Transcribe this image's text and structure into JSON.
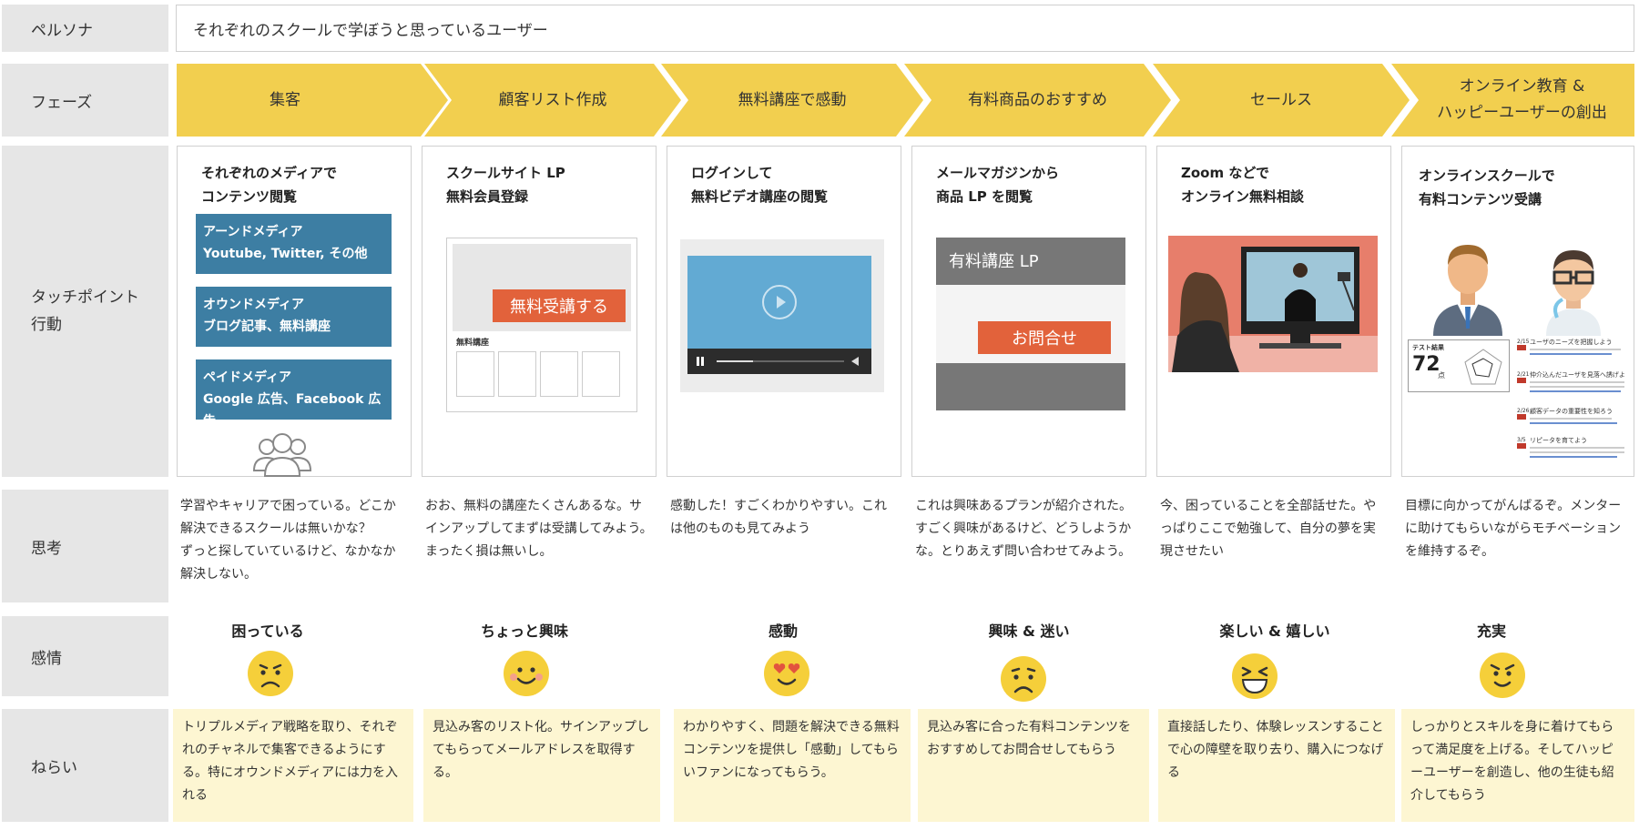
{
  "labels": {
    "persona": "ペルソナ",
    "phase": "フェーズ",
    "touchpoint": "タッチポイント\n行動",
    "thought": "思考",
    "emotion": "感情",
    "aim": "ねらい"
  },
  "persona": "それぞれのスクールで学ぼうと思っているユーザー",
  "phases": [
    "集客",
    "顧客リスト作成",
    "無料講座で感動",
    "有料商品のおすすめ",
    "セールス",
    "オンライン教育 &\nハッピーユーザーの創出"
  ],
  "touchpoints": [
    {
      "title": "それぞれのメディアで\nコンテンツ閲覧"
    },
    {
      "title": "スクールサイト LP\n無料会員登録"
    },
    {
      "title": "ログインして\n無料ビデオ講座の閲覧"
    },
    {
      "title": "メールマガジンから\n商品 LP を閲覧"
    },
    {
      "title": "Zoom などで\nオンライン無料相談"
    },
    {
      "title": "オンラインスクールで\n有料コンテンツ受講"
    }
  ],
  "media": [
    "アーンドメディア\nYoutube, Twitter, その他",
    "オウンドメディア\nブログ記事、無料講座",
    "ペイドメディア\nGoogle 広告、Facebook 広告"
  ],
  "lp": {
    "button": "無料受講する",
    "section": "無料講座"
  },
  "product_lp": {
    "header": "有料講座 LP",
    "button": "お問合せ"
  },
  "dashboard": {
    "score_label": "テスト結果",
    "score": "72",
    "score_unit": "点",
    "items": [
      {
        "date": "2/15",
        "title": "ユーザのニーズを把握しよう"
      },
      {
        "date": "2/21",
        "title": "仲介込んだユーザを見落へ誘げよ"
      },
      {
        "date": "2/26",
        "title": "顧客データの重要性を知ろう"
      },
      {
        "date": "3/5",
        "title": "リピータを育てよう"
      }
    ]
  },
  "thoughts": [
    "学習やキャリアで困っている。どこか解決できるスクールは無いかな？\nずっと探していているけど、なかなか解決しない。",
    "おお、無料の講座たくさんあるな。サインアップしてまずは受講してみよう。まったく損は無いし。",
    "感動した！すごくわかりやすい。これは他のものも見てみよう",
    "これは興味あるプランが紹介された。すごく興味があるけど、どうしようかな。とりあえず問い合わせてみよう。",
    "今、困っていることを全部話せた。やっぱりここで勉強して、自分の夢を実現させたい",
    "目標に向かってがんばるぞ。メンターに助けてもらいながらモチベーションを維持するぞ。"
  ],
  "emotions": [
    {
      "name": "困っている",
      "icon": "worried-face-icon"
    },
    {
      "name": "ちょっと興味",
      "icon": "smile-face-icon"
    },
    {
      "name": "感動",
      "icon": "heart-eyes-face-icon"
    },
    {
      "name": "興味 & 迷い",
      "icon": "frown-face-icon"
    },
    {
      "name": "楽しい & 嬉しい",
      "icon": "laughing-face-icon"
    },
    {
      "name": "充実",
      "icon": "confident-face-icon"
    }
  ],
  "aims": [
    "トリプルメディア戦略を取り、それぞれのチャネルで集客できるようにする。特にオウンドメディアには力を入れる",
    "見込み客のリスト化。サインアップしてもらってメールアドレスを取得する。",
    "わかりやすく、問題を解決できる無料コンテンツを提供し「感動」してもらいファンになってもらう。",
    "見込み客に合った有料コンテンツをおすすめしてお問合せしてもらう",
    "直接話したり、体験レッスンすることで心の障壁を取り去り、購入につなげる",
    "しっかりとスキルを身に着けてもらって満足度を上げる。そしてハッピーユーザーを創造し、他の生徒も紹介してもらう"
  ],
  "colors": {
    "phase": "#f2cf4f",
    "media_blue": "#3d7ea3",
    "orange": "#e2623b",
    "aim_bg": "#fdf6d2",
    "emoji": "#f5cf3a"
  }
}
